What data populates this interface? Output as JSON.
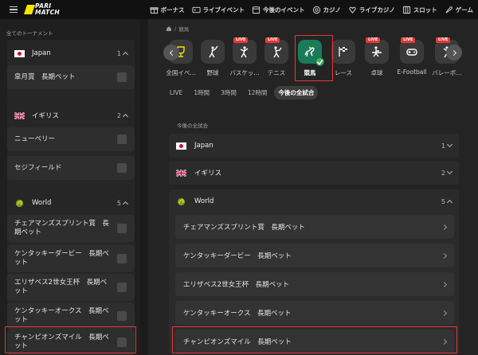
{
  "brand": {
    "logo_text": "PARI MATCH"
  },
  "nav": [
    {
      "label": "ボーナス",
      "icon": "gift-icon"
    },
    {
      "label": "ライブイベント",
      "icon": "live-tv-icon"
    },
    {
      "label": "今後のイベント",
      "icon": "calendar-icon"
    },
    {
      "label": "カジノ",
      "icon": "casino-chip-icon"
    },
    {
      "label": "ライブカジノ",
      "icon": "live-casino-icon"
    },
    {
      "label": "スロット",
      "icon": "slot-icon"
    },
    {
      "label": "ゲーム",
      "icon": "rocket-icon"
    }
  ],
  "sidebar": {
    "title": "全てのトーナメント",
    "groups": [
      {
        "name": "Japan",
        "count": "1",
        "items": [
          "皐月賞　長期ベット"
        ]
      },
      {
        "name": "イギリス",
        "count": "2",
        "items": [
          "ニューベリー",
          "セジフィールド"
        ]
      },
      {
        "name": "World",
        "count": "5",
        "items": [
          "チェアマンズスプリント賞　長期ベット",
          "ケンタッキーダービー　長期ベット",
          "エリザベス2世女王杯　長期ベット",
          "ケンタッキーオークス　長期ベット",
          "チャンピオンズマイル　長期ベット"
        ]
      }
    ]
  },
  "breadcrumb": {
    "sep": "/",
    "current": "競馬"
  },
  "sports": [
    {
      "label": "全国イベ...",
      "live": "",
      "icon": "trophy-icon"
    },
    {
      "label": "野球",
      "live": "",
      "icon": "baseball-icon"
    },
    {
      "label": "バスケッ...",
      "live": "LIVE",
      "icon": "basketball-icon"
    },
    {
      "label": "テニス",
      "live": "LIVE",
      "icon": "tennis-icon"
    },
    {
      "label": "競馬",
      "live": "",
      "icon": "horse-racing-icon"
    },
    {
      "label": "レース",
      "live": "",
      "icon": "race-flag-icon"
    },
    {
      "label": "卓球",
      "live": "LIVE",
      "icon": "table-tennis-icon"
    },
    {
      "label": "E-Football",
      "live": "LIVE",
      "icon": "efootball-icon"
    },
    {
      "label": "バレーボ...",
      "live": "LIVE",
      "icon": "volleyball-icon"
    }
  ],
  "filters": [
    "LIVE",
    "1時間",
    "3時間",
    "12時間",
    "今後の全試合"
  ],
  "main": {
    "section_title": "今後の全試合",
    "groups": [
      {
        "name": "Japan",
        "count": "1"
      },
      {
        "name": "イギリス",
        "count": "2"
      },
      {
        "name": "World",
        "count": "5"
      }
    ],
    "world_items": [
      "チェアマンズスプリント賞　長期ベット",
      "ケンタッキーダービー　長期ベット",
      "エリザベス2世女王杯　長期ベット",
      "ケンタッキーオークス　長期ベット",
      "チャンピオンズマイル　長期ベット"
    ]
  },
  "colors": {
    "accent_green": "#1a7a59",
    "highlight_red": "#e53935",
    "brand_yellow": "#f5e600"
  }
}
